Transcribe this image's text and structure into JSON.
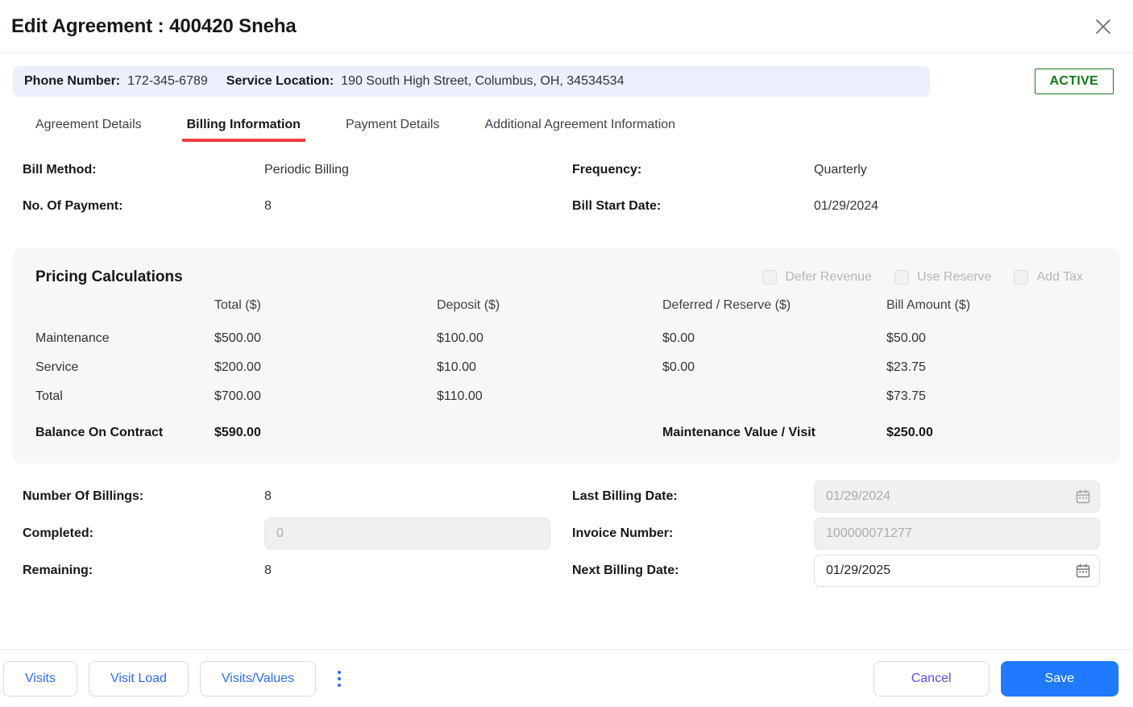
{
  "dialog": {
    "title": "Edit Agreement : 400420 Sneha",
    "close_icon": "close-icon"
  },
  "info_bar": {
    "phone_label": "Phone Number:",
    "phone_value": "172-345-6789",
    "location_label": "Service Location:",
    "location_value": "190 South High Street, Columbus, OH, 34534534",
    "status": "ACTIVE",
    "status_color": "#0f7a16"
  },
  "tabs": [
    {
      "label": "Agreement Details",
      "active": false
    },
    {
      "label": "Billing Information",
      "active": true
    },
    {
      "label": "Payment Details",
      "active": false
    },
    {
      "label": "Additional Agreement Information",
      "active": false
    }
  ],
  "tab_accent_color": "#f23b3b",
  "summary": {
    "bill_method_label": "Bill Method:",
    "bill_method_value": "Periodic Billing",
    "no_of_payment_label": "No. Of Payment:",
    "no_of_payment_value": "8",
    "frequency_label": "Frequency:",
    "frequency_value": "Quarterly",
    "bill_start_date_label": "Bill Start Date:",
    "bill_start_date_value": "01/29/2024"
  },
  "pricing": {
    "title": "Pricing Calculations",
    "checkboxes": [
      {
        "label": "Defer Revenue",
        "checked": false,
        "disabled": true
      },
      {
        "label": "Use Reserve",
        "checked": false,
        "disabled": true
      },
      {
        "label": "Add Tax",
        "checked": false,
        "disabled": true
      }
    ],
    "columns": [
      "",
      "Total ($)",
      "Deposit ($)",
      "Deferred / Reserve ($)",
      "Bill Amount ($)"
    ],
    "rows": [
      {
        "label": "Maintenance",
        "total": "$500.00",
        "deposit": "$100.00",
        "deferred": "$0.00",
        "bill": "$50.00"
      },
      {
        "label": "Service",
        "total": "$200.00",
        "deposit": "$10.00",
        "deferred": "$0.00",
        "bill": "$23.75"
      },
      {
        "label": "Total",
        "total": "$700.00",
        "deposit": "$110.00",
        "deferred": "",
        "bill": "$73.75"
      }
    ],
    "balance_label": "Balance On Contract",
    "balance_value": "$590.00",
    "maint_value_label": "Maintenance Value / Visit",
    "maint_value_value": "$250.00"
  },
  "form": {
    "number_of_billings_label": "Number Of Billings:",
    "number_of_billings_value": "8",
    "completed_label": "Completed:",
    "completed_value": "0",
    "remaining_label": "Remaining:",
    "remaining_value": "8",
    "last_billing_date_label": "Last Billing Date:",
    "last_billing_date_value": "01/29/2024",
    "invoice_number_label": "Invoice Number:",
    "invoice_number_value": "100000071277",
    "next_billing_date_label": "Next Billing Date:",
    "next_billing_date_value": "01/29/2025",
    "calendar_icon": "calendar-icon"
  },
  "footer": {
    "visits_label": "Visits",
    "visit_load_label": "Visit Load",
    "visits_values_label": "Visits/Values",
    "more_icon": "kebab-menu-icon",
    "cancel_label": "Cancel",
    "save_label": "Save",
    "save_color": "#1f7aff"
  }
}
